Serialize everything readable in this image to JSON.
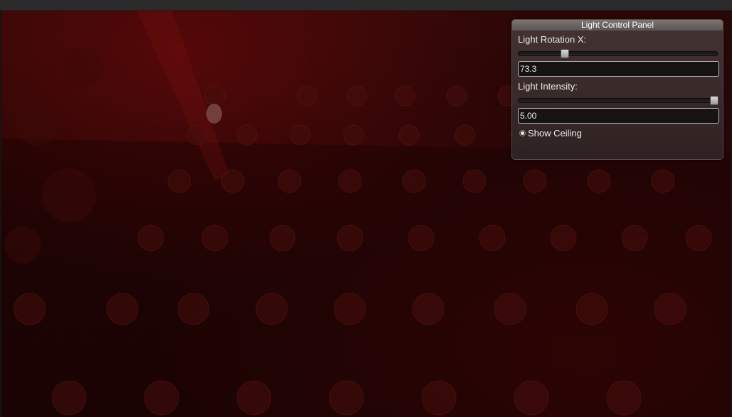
{
  "panel": {
    "title": "Light Control Panel",
    "rotation": {
      "label": "Light Rotation X:",
      "value": "73.3",
      "slider_fraction": 0.22
    },
    "intensity": {
      "label": "Light Intensity:",
      "value": "5.00",
      "slider_fraction": 1.0
    },
    "ceiling": {
      "label": "Show Ceiling",
      "checked": true
    }
  },
  "colors": {
    "scene_background": "#240505",
    "panel_background": "#3c2e2e",
    "panel_title_bar": "#6a6161"
  }
}
